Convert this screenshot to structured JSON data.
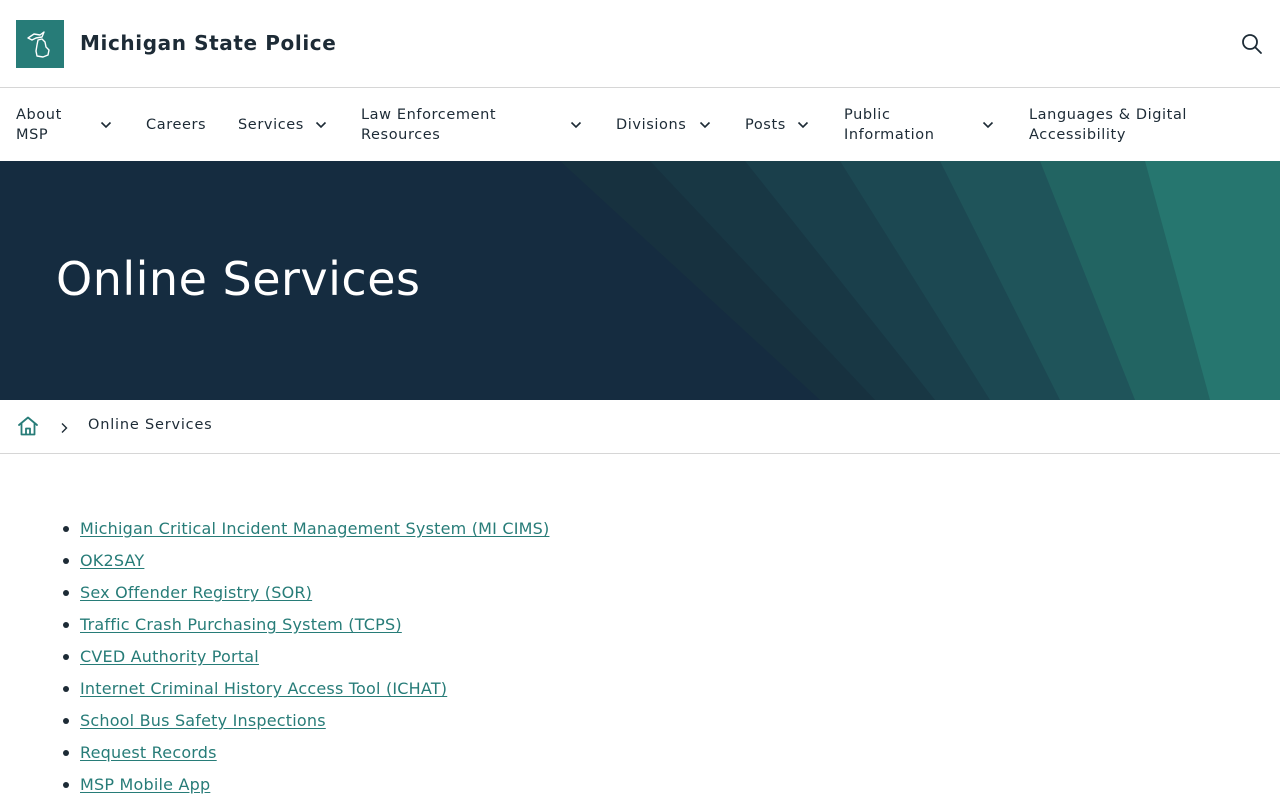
{
  "header": {
    "site_title": "Michigan State Police",
    "logo_icon": "michigan-state-icon",
    "search_icon": "search-icon",
    "brand_color": "#277c78"
  },
  "nav": {
    "items": [
      {
        "label": "About MSP",
        "has_dropdown": true
      },
      {
        "label": "Careers",
        "has_dropdown": false
      },
      {
        "label": "Services",
        "has_dropdown": true
      },
      {
        "label": "Law Enforcement Resources",
        "has_dropdown": true
      },
      {
        "label": "Divisions",
        "has_dropdown": true
      },
      {
        "label": "Posts",
        "has_dropdown": true
      },
      {
        "label": "Public Information",
        "has_dropdown": true
      },
      {
        "label": "Languages & Digital Accessibility",
        "has_dropdown": false
      }
    ]
  },
  "hero": {
    "title": "Online Services",
    "background_color": "#152c40",
    "accent_color": "#277c78"
  },
  "breadcrumb": {
    "home_icon": "home-icon",
    "separator_icon": "chevron-right-icon",
    "current": "Online Services"
  },
  "services": {
    "links": [
      "Michigan Critical Incident Management System (MI CIMS)",
      "OK2SAY",
      "Sex Offender Registry (SOR)",
      "Traffic Crash Purchasing System (TCPS)",
      "CVED Authority Portal",
      "Internet Criminal History Access Tool (ICHAT)",
      "School Bus Safety Inspections",
      "Request Records",
      "MSP Mobile App"
    ]
  }
}
